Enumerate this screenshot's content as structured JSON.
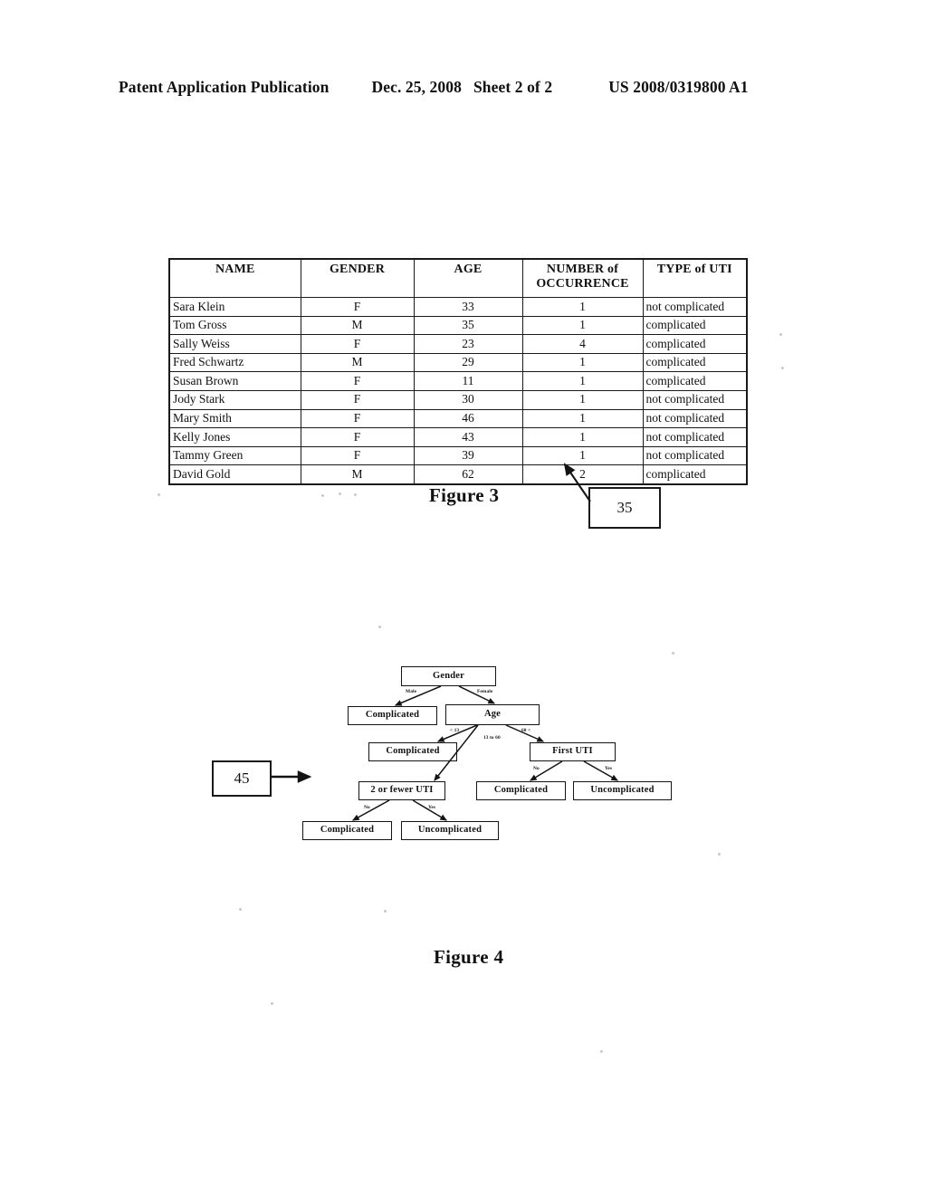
{
  "header": {
    "publication": "Patent Application Publication",
    "date": "Dec. 25, 2008",
    "sheet": "Sheet 2 of 2",
    "patent_number": "US 2008/0319800 A1"
  },
  "figure3": {
    "caption": "Figure 3",
    "reference_number": "35",
    "columns": [
      "NAME",
      "GENDER",
      "AGE",
      "NUMBER of OCCURRENCE",
      "TYPE of UTI"
    ],
    "column_headers": {
      "name": "NAME",
      "gender": "GENDER",
      "age": "AGE",
      "occurrence_line1": "NUMBER of",
      "occurrence_line2": "OCCURRENCE",
      "type": "TYPE of UTI"
    },
    "rows": [
      {
        "name": "Sara Klein",
        "gender": "F",
        "age": "33",
        "occurrence": "1",
        "type": "not complicated"
      },
      {
        "name": "Tom Gross",
        "gender": "M",
        "age": "35",
        "occurrence": "1",
        "type": "complicated"
      },
      {
        "name": "Sally Weiss",
        "gender": "F",
        "age": "23",
        "occurrence": "4",
        "type": "complicated"
      },
      {
        "name": "Fred Schwartz",
        "gender": "M",
        "age": "29",
        "occurrence": "1",
        "type": "complicated"
      },
      {
        "name": "Susan Brown",
        "gender": "F",
        "age": "11",
        "occurrence": "1",
        "type": "complicated"
      },
      {
        "name": "Jody Stark",
        "gender": "F",
        "age": "30",
        "occurrence": "1",
        "type": "not complicated"
      },
      {
        "name": "Mary Smith",
        "gender": "F",
        "age": "46",
        "occurrence": "1",
        "type": "not complicated"
      },
      {
        "name": "Kelly Jones",
        "gender": "F",
        "age": "43",
        "occurrence": "1",
        "type": "not complicated"
      },
      {
        "name": "Tammy Green",
        "gender": "F",
        "age": "39",
        "occurrence": "1",
        "type": "not complicated"
      },
      {
        "name": "David Gold",
        "gender": "M",
        "age": "62",
        "occurrence": "2",
        "type": "complicated"
      }
    ]
  },
  "figure4": {
    "caption": "Figure 4",
    "reference_number": "45",
    "nodes": {
      "root": "Gender",
      "male_leaf": "Complicated",
      "age": "Age",
      "young_leaf": "Complicated",
      "first_uti": "First UTI",
      "two_or_fewer": "2 or fewer UTI",
      "first_uti_no": "Complicated",
      "first_uti_yes": "Uncomplicated",
      "two_no": "Complicated",
      "two_yes": "Uncomplicated"
    },
    "edge_labels": {
      "male": "Male",
      "female": "Female",
      "age_under13": "< 13",
      "age_13to60": "13 to 60",
      "age_over60": "60 <",
      "first_uti_no": "No",
      "first_uti_yes": "Yes",
      "two_no": "No",
      "two_yes": "Yes"
    }
  }
}
